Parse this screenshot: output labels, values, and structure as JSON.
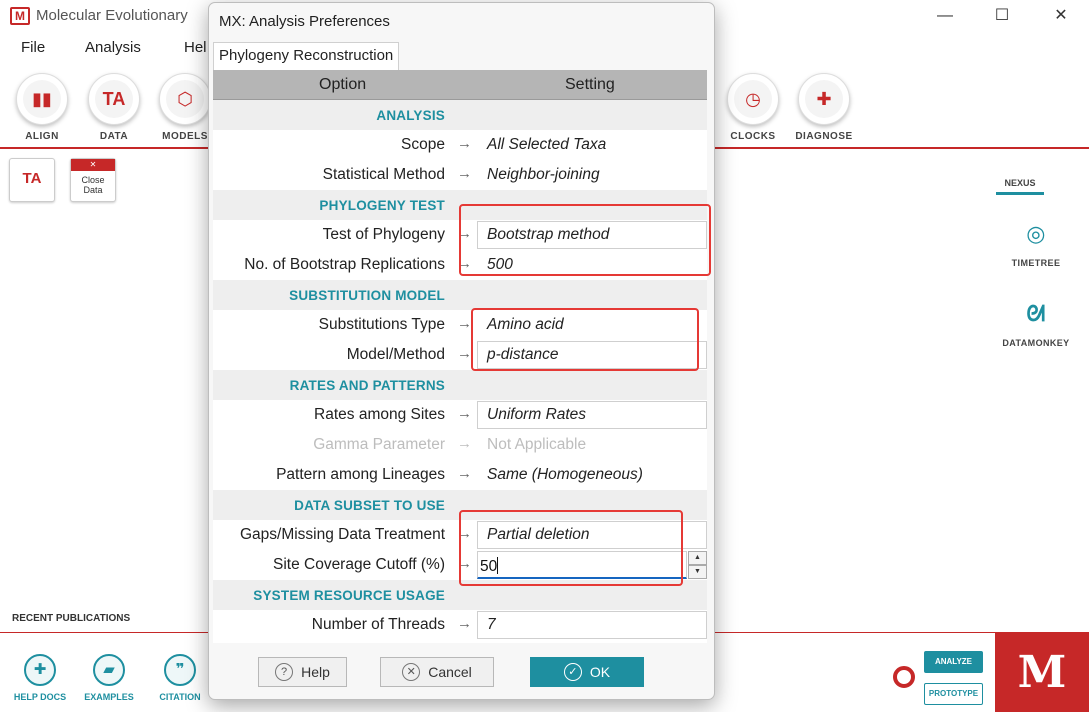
{
  "app": {
    "title": "Molecular Evolutionary",
    "logo": "M",
    "window_controls": [
      "—",
      "☐",
      "✕"
    ]
  },
  "menu": [
    "File",
    "Analysis",
    "Hel"
  ],
  "toolbar": [
    {
      "label": "ALIGN",
      "icon": "align-icon"
    },
    {
      "label": "DATA",
      "icon": "ta-data-icon"
    },
    {
      "label": "MODELS",
      "icon": "models-icon"
    },
    {
      "label": "CLOCKS",
      "icon": "clock-icon"
    },
    {
      "label": "DIAGNOSE",
      "icon": "plus-icon"
    }
  ],
  "toolbar_glyphs": {
    "align": "▮▮",
    "data": "TA",
    "models": "⬡",
    "clocks": "◷",
    "diagnose": "✚"
  },
  "workspace": {
    "ta_icon_text": "TA",
    "close_data": [
      "Close",
      "Data"
    ]
  },
  "side": {
    "tab": "NEXUS",
    "timetree": "TIMETREE",
    "datamonkey": "DATAMONKEY",
    "timetree_glyph": "◎",
    "datamonkey_glyph": "ᘛ"
  },
  "bottom": {
    "recent": "RECENT PUBLICATIONS",
    "help_docs": "HELP DOCS",
    "examples": "EXAMPLES",
    "citation": "CITATION",
    "analyze": "ANALYZE",
    "prototype": "PROTOTYPE",
    "brand": "M",
    "glyphs": {
      "help": "✚",
      "examples": "▰",
      "citation": "❞"
    }
  },
  "dialog": {
    "title": "MX: Analysis Preferences",
    "tab": "Phylogeny Reconstruction",
    "col_option": "Option",
    "col_setting": "Setting",
    "arrow": "→",
    "sections": {
      "analysis": {
        "title": "ANALYSIS",
        "scope_label": "Scope",
        "scope_value": "All Selected Taxa",
        "stat_label": "Statistical Method",
        "stat_value": "Neighbor-joining"
      },
      "phylogeny_test": {
        "title": "PHYLOGENY TEST",
        "test_label": "Test of Phylogeny",
        "test_value": "Bootstrap method",
        "reps_label": "No. of Bootstrap Replications",
        "reps_value": "500"
      },
      "substitution_model": {
        "title": "SUBSTITUTION MODEL",
        "type_label": "Substitutions Type",
        "type_value": "Amino acid",
        "model_label": "Model/Method",
        "model_value": "p-distance"
      },
      "rates_patterns": {
        "title": "RATES AND PATTERNS",
        "rates_label": "Rates among Sites",
        "rates_value": "Uniform Rates",
        "gamma_label": "Gamma Parameter",
        "gamma_value": "Not Applicable",
        "pattern_label": "Pattern among Lineages",
        "pattern_value": "Same (Homogeneous)"
      },
      "data_subset": {
        "title": "DATA SUBSET TO USE",
        "gaps_label": "Gaps/Missing Data Treatment",
        "gaps_value": "Partial deletion",
        "cutoff_label": "Site Coverage Cutoff (%)",
        "cutoff_value": "50"
      },
      "system": {
        "title": "SYSTEM RESOURCE USAGE",
        "threads_label": "Number of Threads",
        "threads_value": "7"
      }
    },
    "buttons": {
      "help": "Help",
      "cancel": "Cancel",
      "ok": "OK"
    },
    "button_glyphs": {
      "help": "?",
      "cancel": "✕",
      "ok": "✓"
    },
    "spin_glyphs": {
      "up": "▲",
      "down": "▼"
    }
  },
  "colors": {
    "brand": "#c62828",
    "accent": "#1e8fa0",
    "highlight": "#e53935"
  }
}
